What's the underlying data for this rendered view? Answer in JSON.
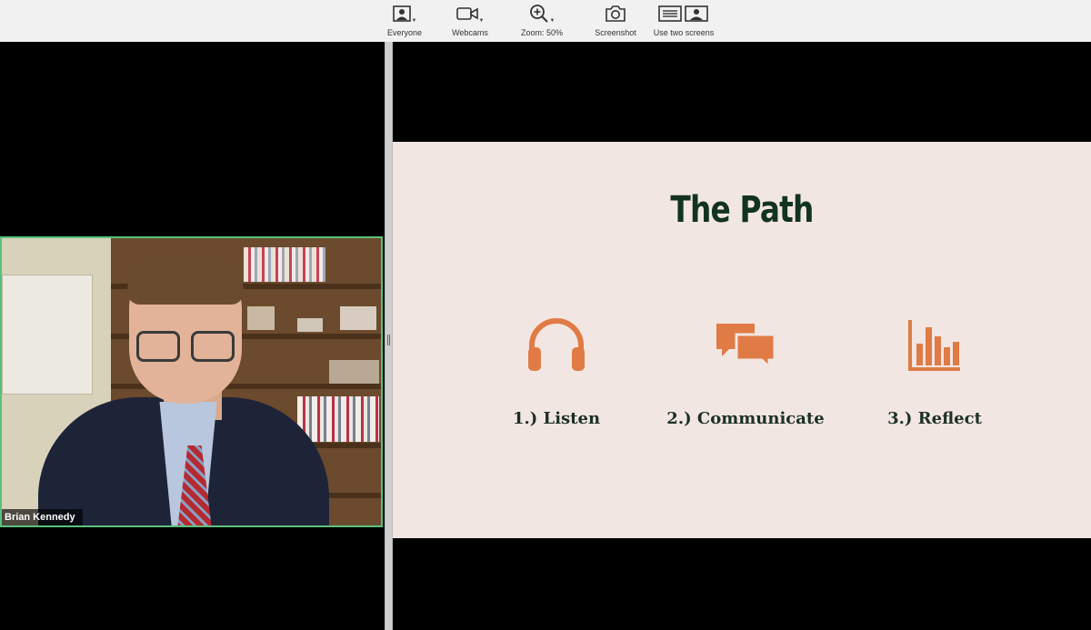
{
  "toolbar": {
    "items": [
      {
        "label": "Everyone",
        "icon": "person-frame-icon"
      },
      {
        "label": "Webcams",
        "icon": "video-camera-icon"
      },
      {
        "label": "Zoom: 50%",
        "icon": "zoom-in-icon"
      },
      {
        "label": "Screenshot",
        "icon": "camera-icon"
      },
      {
        "label": "Use two screens",
        "icon": "two-screens-icon"
      }
    ]
  },
  "video": {
    "participant_name": "Brian Kennedy",
    "active_border_color": "#58c27a"
  },
  "slide": {
    "title": "The Path",
    "title_color": "#133321",
    "accent_color": "#e07b45",
    "background": "#f2e6e2",
    "steps": [
      {
        "label": "1.) Listen",
        "icon": "headphones-icon"
      },
      {
        "label": "2.) Communicate",
        "icon": "speech-bubbles-icon"
      },
      {
        "label": "3.) Reflect",
        "icon": "bar-chart-icon"
      }
    ]
  }
}
